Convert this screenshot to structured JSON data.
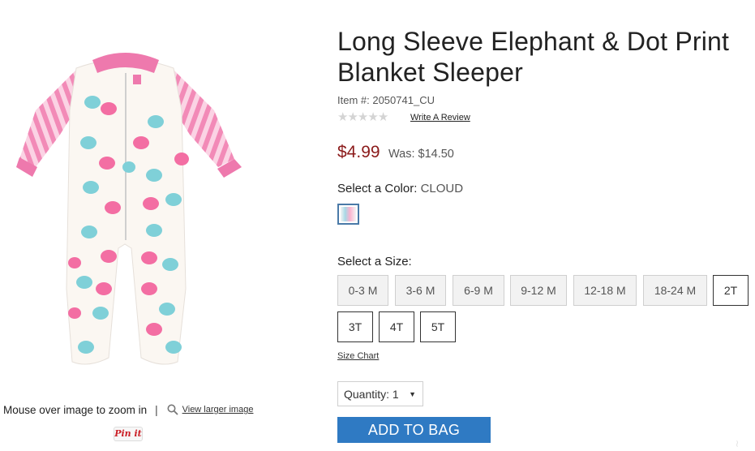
{
  "product": {
    "title": "Long Sleeve Elephant & Dot Print Blanket Sleeper",
    "item_number": "Item #: 2050741_CU",
    "rating_stars": 0,
    "write_review": "Write A Review",
    "price": "$4.99",
    "was_price": "Was: $14.50"
  },
  "gallery": {
    "image_icon": "footed-sleeper-image",
    "zoom_hint": "Mouse over image to zoom in",
    "separator": "|",
    "view_larger": "View larger image",
    "pin_it": "Pin it"
  },
  "color": {
    "label": "Select a Color:",
    "value": "CLOUD"
  },
  "size": {
    "label": "Select a Size:",
    "options": [
      {
        "label": "0-3 M",
        "available": false
      },
      {
        "label": "3-6 M",
        "available": false
      },
      {
        "label": "6-9 M",
        "available": false
      },
      {
        "label": "9-12 M",
        "available": false
      },
      {
        "label": "12-18 M",
        "available": false
      },
      {
        "label": "18-24 M",
        "available": false
      },
      {
        "label": "2T",
        "available": true
      },
      {
        "label": "3T",
        "available": true
      },
      {
        "label": "4T",
        "available": true
      },
      {
        "label": "5T",
        "available": true
      }
    ],
    "chart_link": "Size Chart"
  },
  "quantity": {
    "label": "Quantity: 1"
  },
  "actions": {
    "add_to_bag": "ADD TO BAG"
  },
  "colors": {
    "price_red": "#8b1a1a",
    "button_blue": "#2f7ac3",
    "swatch_border": "#4a7aa8"
  }
}
